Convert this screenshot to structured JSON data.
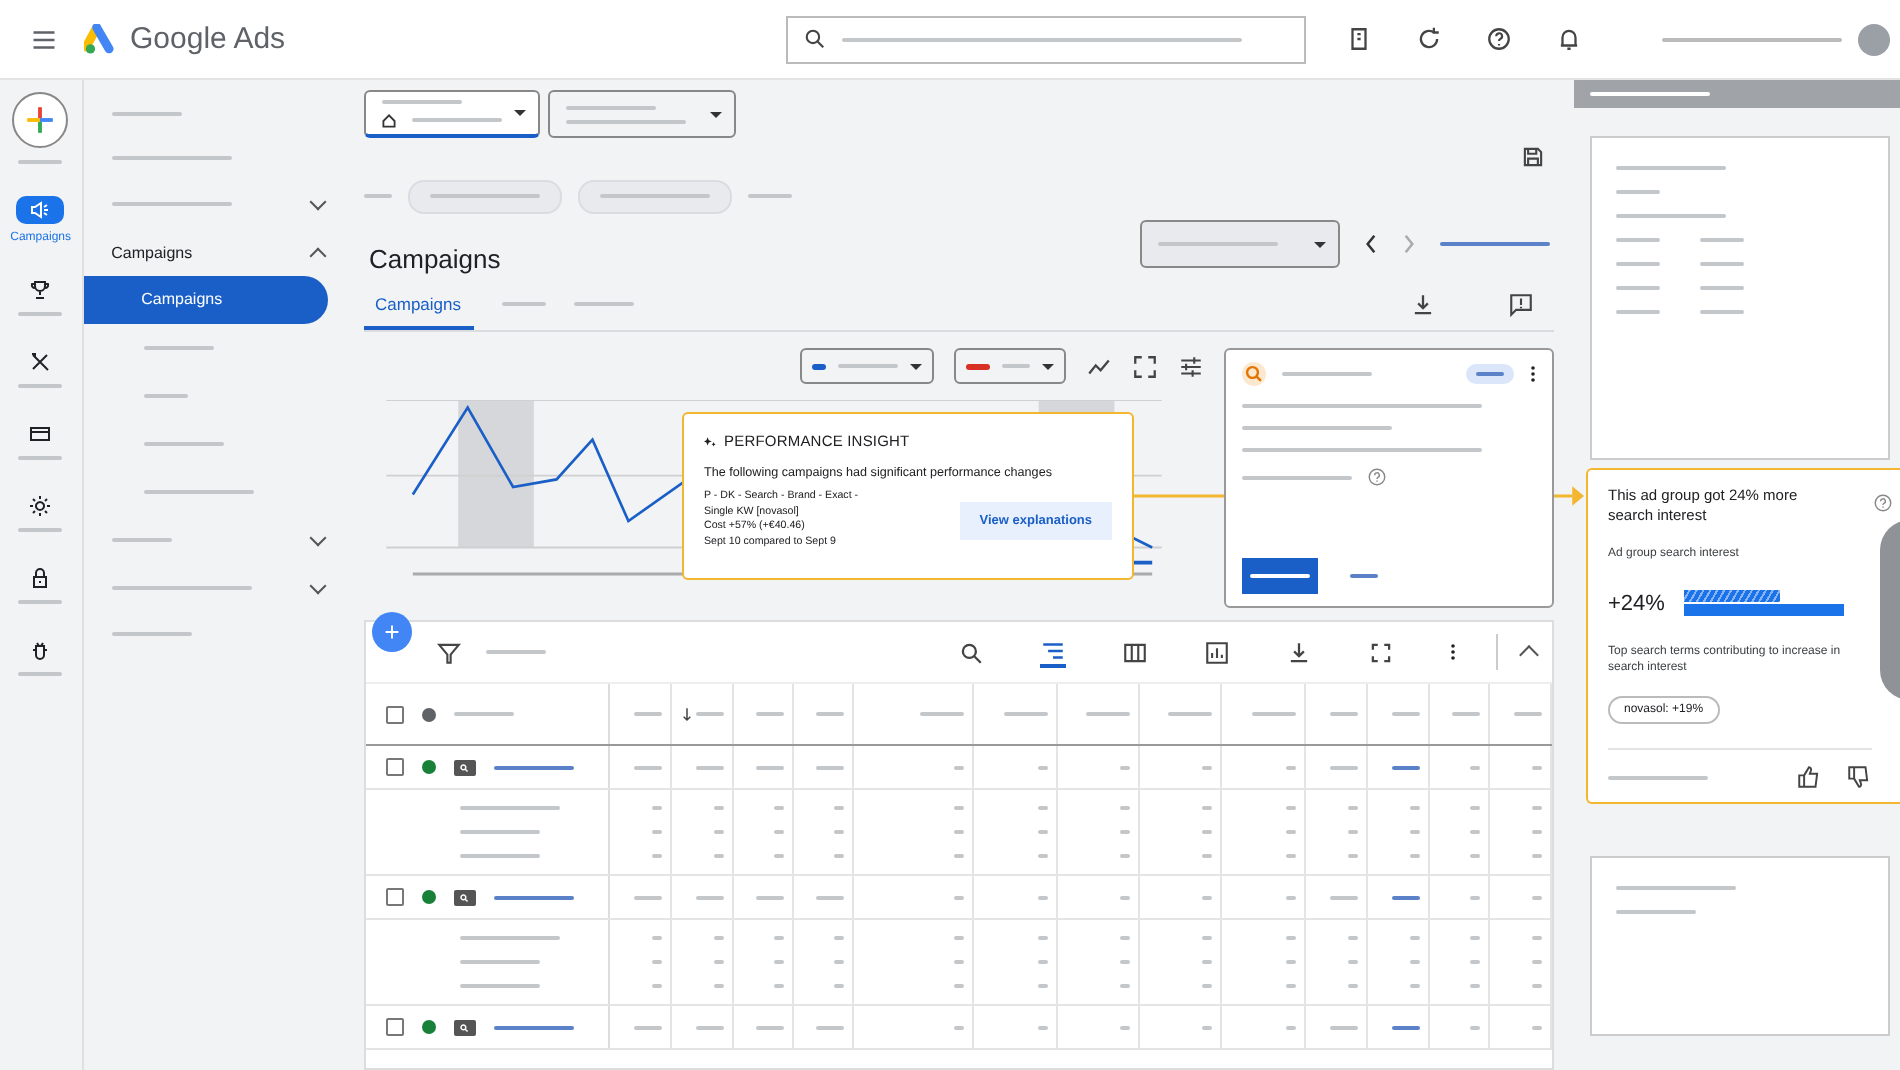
{
  "header": {
    "product": "Google Ads"
  },
  "rail": [
    {
      "kind": "campaigns",
      "label": "Campaigns",
      "selected": true
    },
    {
      "kind": "trophy",
      "selected": false
    },
    {
      "kind": "tools",
      "selected": false
    },
    {
      "kind": "card",
      "selected": false
    },
    {
      "kind": "gear",
      "selected": false
    },
    {
      "kind": "lock",
      "selected": false
    },
    {
      "kind": "bug",
      "selected": false
    }
  ],
  "sidebar": {
    "group": {
      "label": "Campaigns",
      "expanded": true,
      "children": [
        {
          "label": "Campaigns",
          "selected": true
        }
      ]
    }
  },
  "page": {
    "title": "Campaigns",
    "tabs": [
      {
        "label": "Campaigns",
        "selected": true
      }
    ]
  },
  "insight": {
    "title": "PERFORMANCE INSIGHT",
    "summary": "The following campaigns had significant performance changes",
    "details": [
      "P - DK - Search - Brand - Exact -",
      "Single KW [novasol]",
      "Cost +57% (+€40.46)",
      "Sept 10 compared to Sept 9"
    ],
    "button": "View explanations"
  },
  "detail_card": {
    "title": "This ad group got 24% more search interest",
    "metric_label": "Ad group search interest",
    "value": "+24%",
    "bar": {
      "level": 0.6
    },
    "terms_label": "Top search terms contributing to increase in search interest",
    "chip": "novasol: +19%"
  },
  "table": {
    "header": {
      "checked": false,
      "color": "#5f6368"
    },
    "rows": [
      {
        "checked": false,
        "color": "#188038",
        "expanded": true
      },
      {
        "checked": false,
        "color": "#188038",
        "expanded": true
      },
      {
        "checked": false,
        "color": "#188038",
        "expanded": false
      }
    ]
  }
}
